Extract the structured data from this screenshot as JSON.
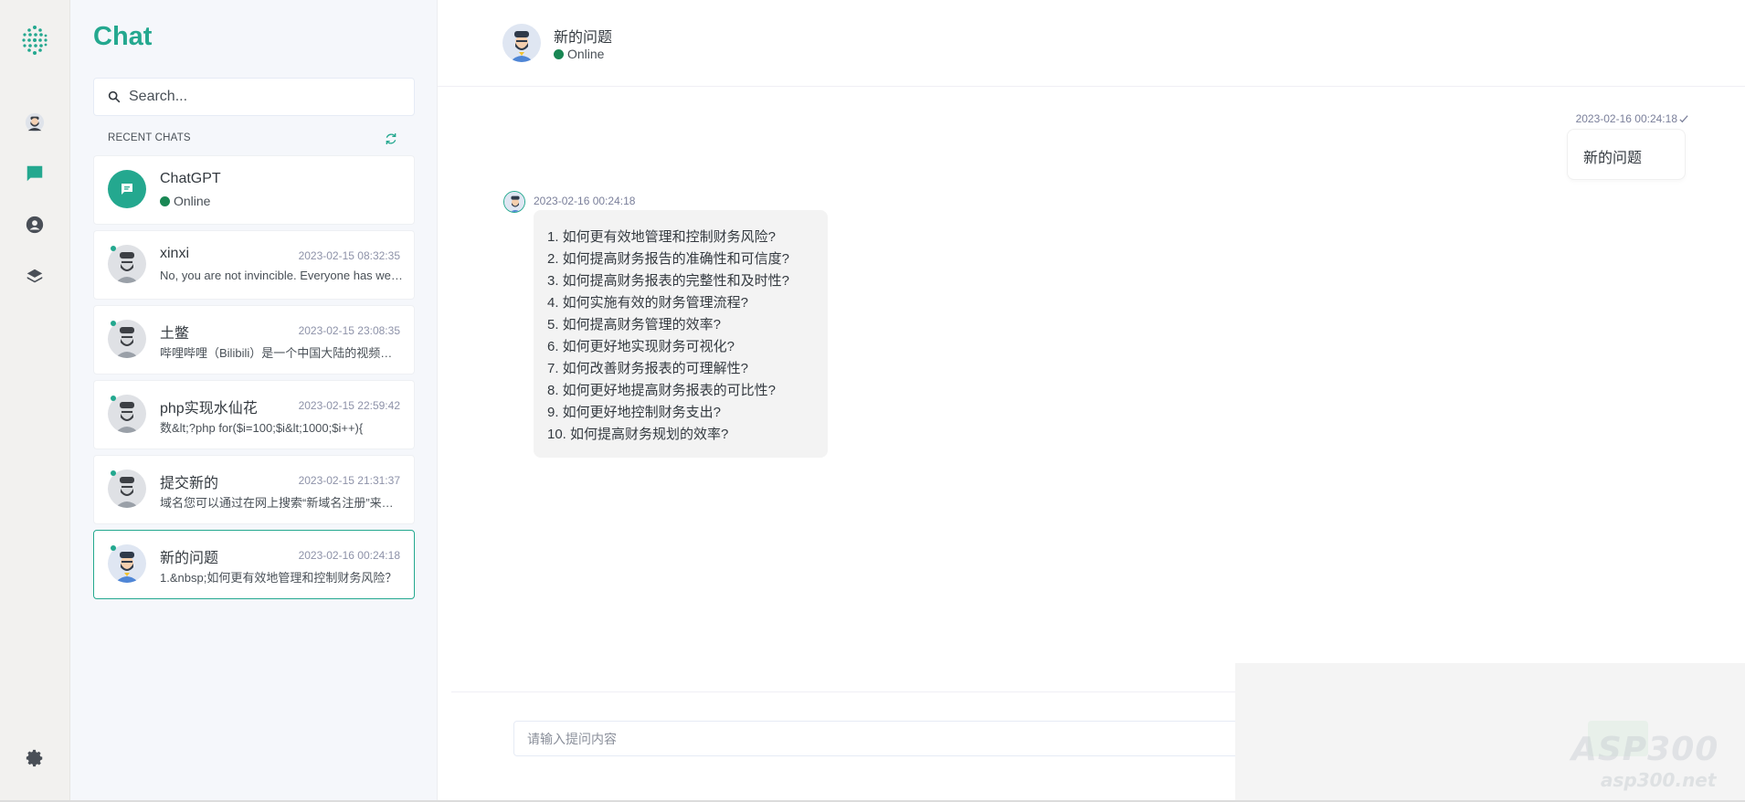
{
  "sidebar": {
    "title": "Chat",
    "search_placeholder": "Search...",
    "recent_label": "RECENT CHATS",
    "chats": [
      {
        "name": "ChatGPT",
        "status": "Online"
      },
      {
        "name": "xinxi",
        "time": "2023-02-15 08:32:35",
        "preview": "No, you are not invincible. Everyone has weaknesses and limits."
      },
      {
        "name": "土鳖",
        "time": "2023-02-15 23:08:35",
        "preview": "哔哩哔哩（Bilibili）是一个中国大陆的视频网站"
      },
      {
        "name": "php实现水仙花",
        "time": "2023-02-15 22:59:42",
        "preview": "数&lt;?php for($i=100;$i&lt;1000;$i++){"
      },
      {
        "name": "提交新的",
        "time": "2023-02-15 21:31:37",
        "preview": "域名您可以通过在网上搜索“新域名注册”来找到"
      },
      {
        "name": "新的问题",
        "time": "2023-02-16 00:24:18",
        "preview": "1.&nbsp;如何更有效地管理和控制财务风险？"
      }
    ]
  },
  "header": {
    "name": "新的问题",
    "status": "Online"
  },
  "messages": {
    "user": {
      "time": "2023-02-16 00:24:18",
      "text": "新的问题"
    },
    "bot": {
      "time": "2023-02-16 00:24:18",
      "lines": [
        "1. 如何更有效地管理和控制财务风险?",
        "2. 如何提高财务报告的准确性和可信度?",
        "3. 如何提高财务报表的完整性和及时性?",
        "4. 如何实施有效的财务管理流程?",
        "5. 如何提高财务管理的效率?",
        "6. 如何更好地实现财务可视化?",
        "7. 如何改善财务报表的可理解性?",
        "8. 如何更好地提高财务报表的可比性?",
        "9. 如何更好地控制财务支出?",
        "10. 如何提高财务规划的效率?"
      ]
    }
  },
  "composer": {
    "placeholder": "请输入提问内容"
  },
  "watermark": {
    "main": "ASP300",
    "sub": "asp300.net"
  },
  "colors": {
    "accent": "#24a88f",
    "online": "#198754"
  }
}
